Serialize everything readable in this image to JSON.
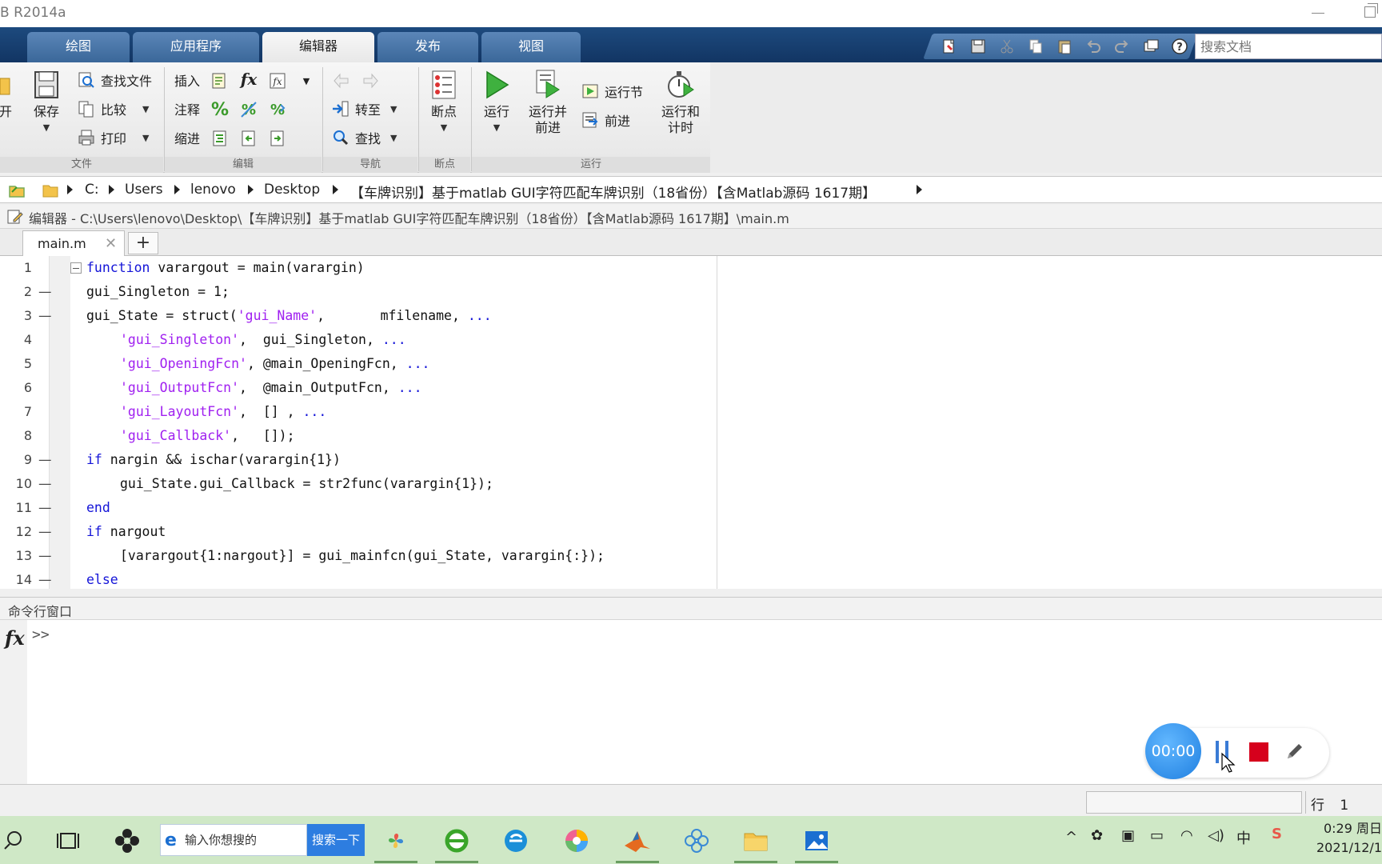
{
  "window": {
    "title": "B R2014a"
  },
  "tabs": [
    {
      "label": "绘图"
    },
    {
      "label": "应用程序"
    },
    {
      "label": "编辑器"
    },
    {
      "label": "发布"
    },
    {
      "label": "视图"
    }
  ],
  "search_docs": {
    "placeholder": "搜索文档"
  },
  "ribbon": {
    "file": {
      "open_label": "开",
      "save_label": "保存",
      "find_files": "查找文件",
      "compare": "比较",
      "print": "打印",
      "group": "文件"
    },
    "edit": {
      "insert": "插入",
      "comment": "注释",
      "indent": "缩进",
      "fx_label": "fx",
      "group": "编辑"
    },
    "navigate": {
      "goto": "转至",
      "find": "查找",
      "group": "导航"
    },
    "breakpoints": {
      "label": "断点",
      "group": "断点"
    },
    "run": {
      "run": "运行",
      "run_advance_1": "运行并",
      "run_advance_2": "前进",
      "run_section": "运行节",
      "advance": "前进",
      "run_time_1": "运行和",
      "run_time_2": "计时",
      "group": "运行"
    }
  },
  "address": {
    "crumbs": [
      "C:",
      "Users",
      "lenovo",
      "Desktop",
      "【车牌识别】基于matlab GUI字符匹配车牌识别（18省份）【含Matlab源码 1617期】"
    ]
  },
  "editor": {
    "header": "编辑器 - C:\\Users\\lenovo\\Desktop\\【车牌识别】基于matlab GUI字符匹配车牌识别（18省份）【含Matlab源码 1617期】\\main.m",
    "tab": "main.m",
    "lines": [
      {
        "n": "1",
        "dash": "",
        "fold": true,
        "indent": 0,
        "segs": [
          [
            "kw",
            "function"
          ],
          [
            "t",
            " varargout = main(varargin)"
          ]
        ]
      },
      {
        "n": "2",
        "dash": "—",
        "fold": false,
        "indent": 0,
        "segs": [
          [
            "t",
            "gui_Singleton = 1;"
          ]
        ]
      },
      {
        "n": "3",
        "dash": "—",
        "fold": false,
        "indent": 0,
        "segs": [
          [
            "t",
            "gui_State = struct("
          ],
          [
            "str",
            "'gui_Name'"
          ],
          [
            "t",
            ",       mfilename, "
          ],
          [
            "dots",
            "..."
          ]
        ]
      },
      {
        "n": "4",
        "dash": "",
        "fold": false,
        "indent": 1,
        "segs": [
          [
            "str",
            "'gui_Singleton'"
          ],
          [
            "t",
            ",  gui_Singleton, "
          ],
          [
            "dots",
            "..."
          ]
        ]
      },
      {
        "n": "5",
        "dash": "",
        "fold": false,
        "indent": 1,
        "segs": [
          [
            "str",
            "'gui_OpeningFcn'"
          ],
          [
            "t",
            ", @main_OpeningFcn, "
          ],
          [
            "dots",
            "..."
          ]
        ]
      },
      {
        "n": "6",
        "dash": "",
        "fold": false,
        "indent": 1,
        "segs": [
          [
            "str",
            "'gui_OutputFcn'"
          ],
          [
            "t",
            ",  @main_OutputFcn, "
          ],
          [
            "dots",
            "..."
          ]
        ]
      },
      {
        "n": "7",
        "dash": "",
        "fold": false,
        "indent": 1,
        "segs": [
          [
            "str",
            "'gui_LayoutFcn'"
          ],
          [
            "t",
            ",  [] , "
          ],
          [
            "dots",
            "..."
          ]
        ]
      },
      {
        "n": "8",
        "dash": "",
        "fold": false,
        "indent": 1,
        "segs": [
          [
            "str",
            "'gui_Callback'"
          ],
          [
            "t",
            ",   []);"
          ]
        ]
      },
      {
        "n": "9",
        "dash": "—",
        "fold": false,
        "indent": 0,
        "segs": [
          [
            "kw",
            "if"
          ],
          [
            "t",
            " nargin && ischar(varargin{1})"
          ]
        ]
      },
      {
        "n": "10",
        "dash": "—",
        "fold": false,
        "indent": 1,
        "segs": [
          [
            "t",
            "gui_State.gui_Callback = str2func(varargin{1});"
          ]
        ]
      },
      {
        "n": "11",
        "dash": "—",
        "fold": false,
        "indent": 0,
        "segs": [
          [
            "kw",
            "end"
          ]
        ]
      },
      {
        "n": "12",
        "dash": "—",
        "fold": false,
        "indent": 0,
        "segs": [
          [
            "kw",
            "if"
          ],
          [
            "t",
            " nargout"
          ]
        ]
      },
      {
        "n": "13",
        "dash": "—",
        "fold": false,
        "indent": 1,
        "segs": [
          [
            "t",
            "[varargout{1:nargout}] = gui_mainfcn(gui_State, varargin{:});"
          ]
        ]
      },
      {
        "n": "14",
        "dash": "—",
        "fold": false,
        "indent": 0,
        "segs": [
          [
            "kw",
            "else"
          ]
        ]
      }
    ]
  },
  "command_window": {
    "title": "命令行窗口",
    "fx": "fx",
    "prompt": ">>"
  },
  "recorder": {
    "timer": "00:00"
  },
  "status": {
    "line_label": "行",
    "line_value": "1"
  },
  "taskbar": {
    "search_placeholder": "输入你想搜的",
    "search_button": "搜索一下",
    "input_method": "中",
    "time": "0:29 周日",
    "date": "2021/12/1"
  }
}
